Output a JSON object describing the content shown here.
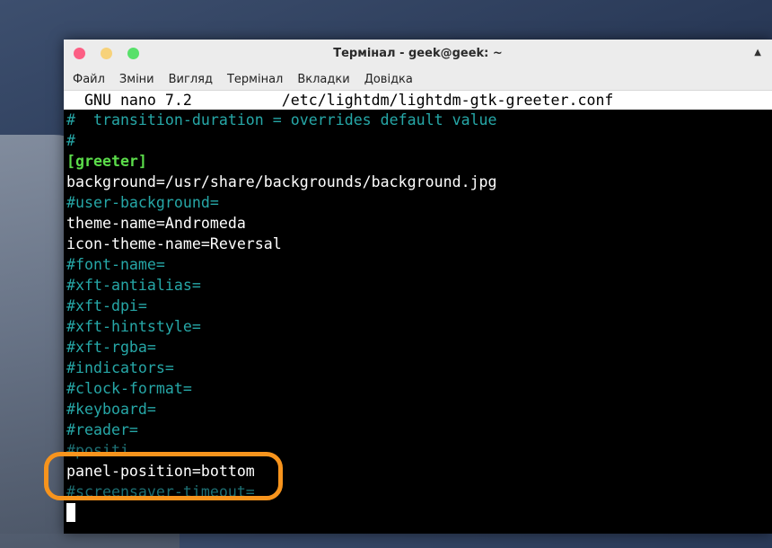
{
  "window": {
    "title": "Термінал - geek@geek: ~",
    "maximize_glyph": "▲"
  },
  "menu": [
    "Файл",
    "Зміни",
    "Вигляд",
    "Термінал",
    "Вкладки",
    "Довідка"
  ],
  "nano": {
    "version": "GNU nano 7.2",
    "file": "/etc/lightdm/lightdm-gtk-greeter.conf"
  },
  "lines": [
    {
      "text": "#  transition-duration = overrides default value",
      "style": "comment"
    },
    {
      "text": "#",
      "style": "comment"
    },
    {
      "text": "[greeter]",
      "style": "section"
    },
    {
      "text": "background=/usr/share/backgrounds/background.jpg",
      "style": "plain"
    },
    {
      "text": "#user-background=",
      "style": "comment"
    },
    {
      "text": "theme-name=Andromeda",
      "style": "plain"
    },
    {
      "text": "icon-theme-name=Reversal",
      "style": "plain"
    },
    {
      "text": "#font-name=",
      "style": "comment"
    },
    {
      "text": "#xft-antialias=",
      "style": "comment"
    },
    {
      "text": "#xft-dpi=",
      "style": "comment"
    },
    {
      "text": "#xft-hintstyle=",
      "style": "comment"
    },
    {
      "text": "#xft-rgba=",
      "style": "comment"
    },
    {
      "text": "#indicators=",
      "style": "comment"
    },
    {
      "text": "#clock-format=",
      "style": "comment"
    },
    {
      "text": "#keyboard=",
      "style": "comment"
    },
    {
      "text": "#reader=",
      "style": "comment"
    },
    {
      "text": "#positi",
      "style": "dim"
    },
    {
      "text": "panel-position=bottom",
      "style": "plain"
    },
    {
      "text": "#screensaver-timeout=",
      "style": "dim"
    }
  ],
  "colors": {
    "highlight": "#f7941d",
    "comment": "#26a7a7",
    "section": "#5bdc4a"
  }
}
